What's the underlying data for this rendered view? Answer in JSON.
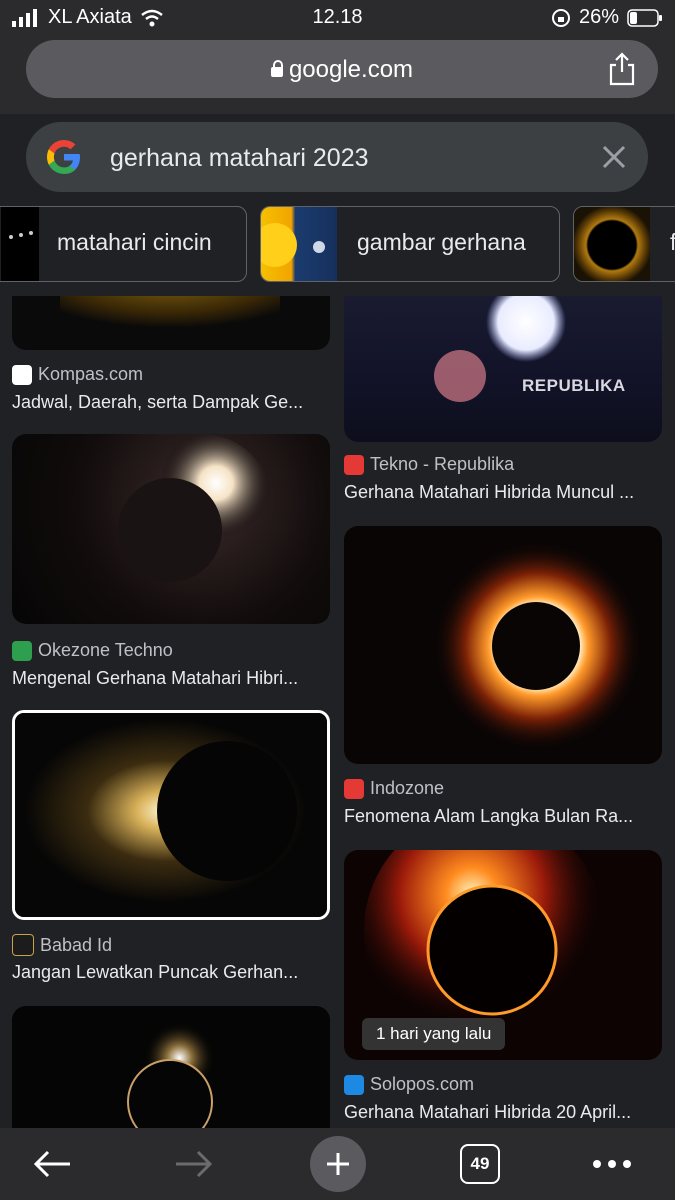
{
  "status": {
    "carrier": "XL Axiata",
    "time": "12.18",
    "battery": "26%"
  },
  "browser": {
    "url": "google.com"
  },
  "search": {
    "query": "gerhana matahari 2023"
  },
  "chips": [
    {
      "label": "matahari cincin"
    },
    {
      "label": "gambar gerhana"
    },
    {
      "label": "f"
    }
  ],
  "results": {
    "left": [
      {
        "source": "Kompas.com",
        "title": "Jadwal, Daerah, serta Dampak Ge..."
      },
      {
        "source": "Okezone Techno",
        "title": "Mengenal Gerhana Matahari Hibri..."
      },
      {
        "source": "Babad Id",
        "title": "Jangan Lewatkan Puncak Gerhan..."
      }
    ],
    "right": [
      {
        "source": "Tekno - Republika",
        "title": "Gerhana Matahari Hibrida Muncul ...",
        "watermark": "REPUBLIKA"
      },
      {
        "source": "Indozone",
        "title": "Fenomena Alam Langka Bulan Ra..."
      },
      {
        "source": "Solopos.com",
        "title": "Gerhana Matahari Hibrida 20 April...",
        "badge": "1 hari yang lalu"
      }
    ]
  },
  "toolbar": {
    "tab_count": "49"
  }
}
